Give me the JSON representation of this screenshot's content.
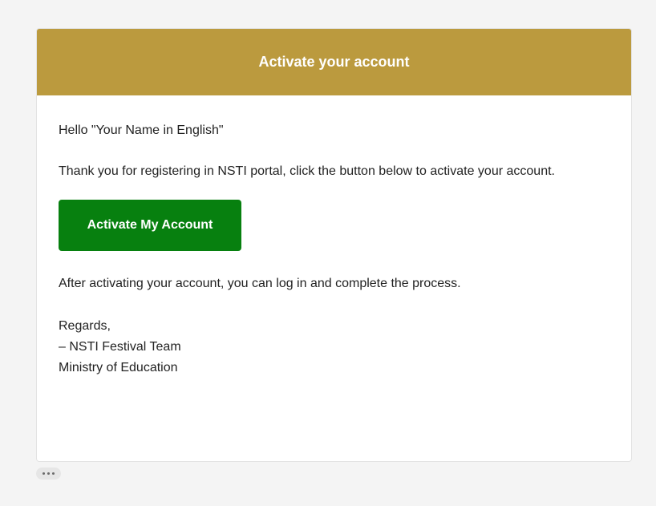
{
  "email": {
    "header_title": "Activate your account",
    "greeting": "Hello \"Your Name in English\"",
    "intro": "Thank you for registering in NSTI portal, click the button below to activate your account.",
    "button_label": "Activate My Account",
    "after_text": "After activating your account, you can log in and complete the process.",
    "signature": {
      "regards": "Regards,",
      "team": "– NSTI Festival Team",
      "ministry": "Ministry of Education"
    }
  },
  "colors": {
    "header_bg": "#bb9a3e",
    "button_bg": "#07800f"
  },
  "icons": {
    "more_toggle": "ellipsis-icon"
  }
}
